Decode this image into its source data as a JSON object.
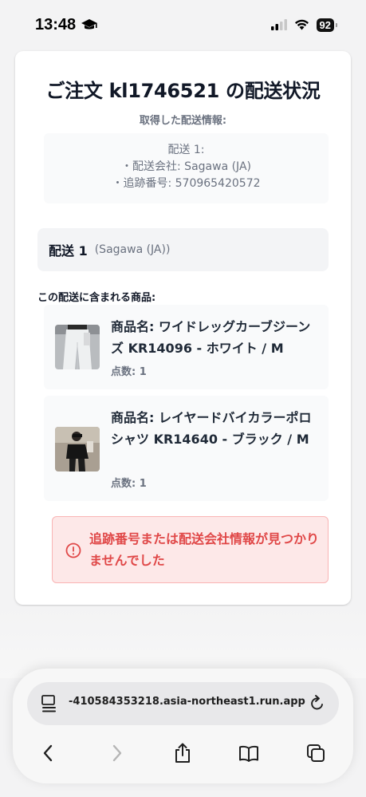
{
  "status_bar": {
    "time": "13:48",
    "battery": "92"
  },
  "order": {
    "title": "ご注文 kl1746521 の配送状況",
    "subtitle": "取得した配送情報:",
    "info_lines": [
      "配送 1:",
      "・配送会社: Sagawa (JA)",
      "・追跡番号: 570965420572"
    ]
  },
  "shipment": {
    "name": "配送 1",
    "carrier": "(Sagawa (JA))",
    "contains_label": "この配送に含まれる商品:",
    "products": [
      {
        "name": "商品名: ワイドレッグカーブジーンズ KR14096 - ホワイト / M",
        "qty": "点数: 1",
        "thumb_icon": "white-jeans-photo"
      },
      {
        "name": "商品名: レイヤードバイカラーポロシャツ KR14640 - ブラック / M",
        "qty": "点数: 1",
        "thumb_icon": "black-polo-photo"
      }
    ]
  },
  "error": {
    "message": "追跡番号または配送会社情報が見つかりませんでした",
    "color": "#e04848"
  },
  "browser": {
    "url": "-410584353218.asia-northeast1.run.app"
  }
}
